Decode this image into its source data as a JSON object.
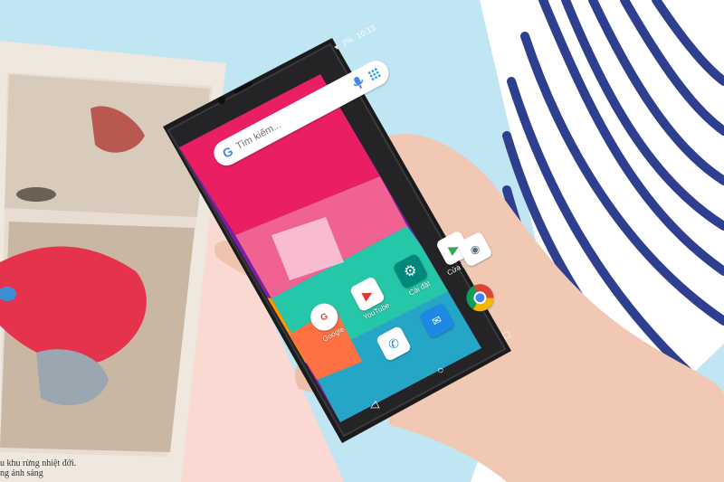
{
  "status_bar": {
    "battery": "7%",
    "time": "10:13"
  },
  "search": {
    "placeholder": "Tìm kiếm..."
  },
  "apps": [
    {
      "label": "Google"
    },
    {
      "label": "YouTube"
    },
    {
      "label": "Cài đặt"
    },
    {
      "label": "Cửa hàn..."
    }
  ],
  "magazine": {
    "caption_line1": "u khu rừng nhiệt đới.",
    "caption_line2": "ng ánh sáng"
  },
  "colors": {
    "accent_pink": "#f0397d",
    "accent_orange": "#f79a1f",
    "teal": "#40cfb5"
  }
}
